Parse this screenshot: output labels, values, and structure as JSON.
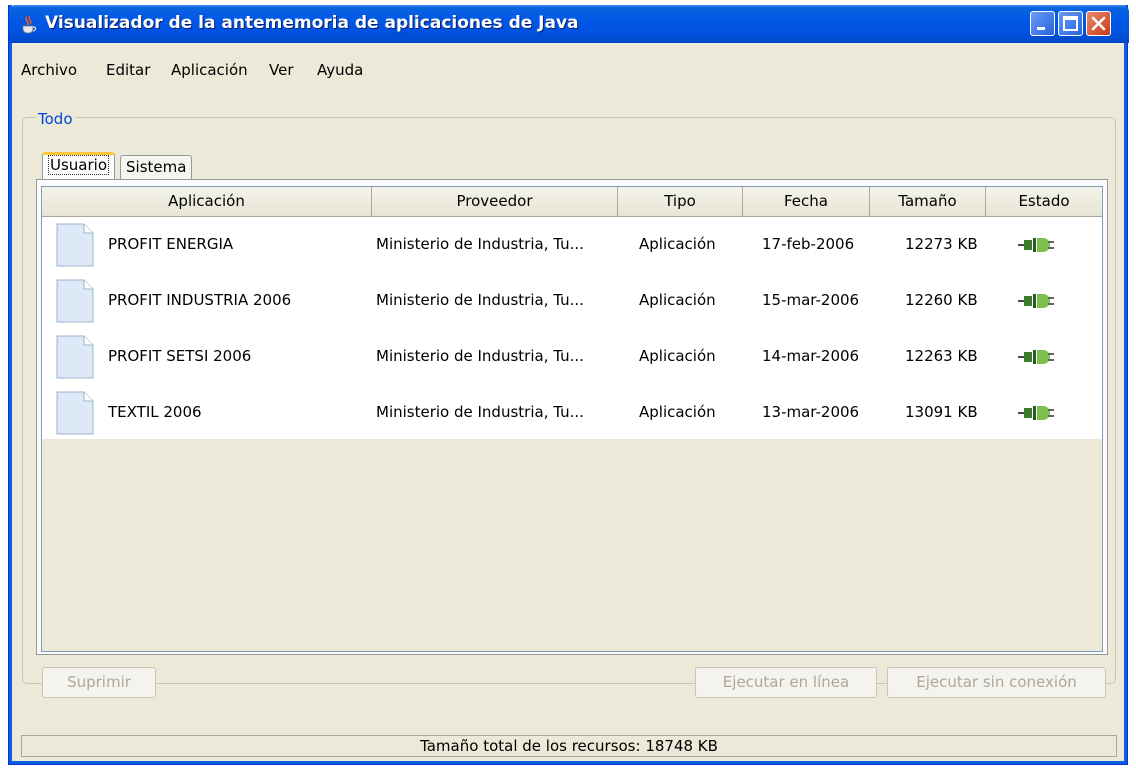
{
  "window": {
    "title": "Visualizador de la antememoria de aplicaciones de Java"
  },
  "menu": [
    "Archivo",
    "Editar",
    "Aplicación",
    "Ver",
    "Ayuda"
  ],
  "group_label": "Todo",
  "tabs": [
    "Usuario",
    "Sistema"
  ],
  "active_tab": "Usuario",
  "table": {
    "columns": [
      "Aplicación",
      "Proveedor",
      "Tipo",
      "Fecha",
      "Tamaño",
      "Estado"
    ],
    "rows": [
      {
        "app": "PROFIT ENERGIA",
        "vendor": "Ministerio de Industria, Tu...",
        "type": "Aplicación",
        "date": "17-feb-2006",
        "size": "12273 KB",
        "status_icon": "plug-icon"
      },
      {
        "app": "PROFIT INDUSTRIA 2006",
        "vendor": "Ministerio de Industria, Tu...",
        "type": "Aplicación",
        "date": "15-mar-2006",
        "size": "12260 KB",
        "status_icon": "plug-icon"
      },
      {
        "app": "PROFIT SETSI 2006",
        "vendor": "Ministerio de Industria, Tu...",
        "type": "Aplicación",
        "date": "14-mar-2006",
        "size": "12263 KB",
        "status_icon": "plug-icon"
      },
      {
        "app": "TEXTIL 2006",
        "vendor": "Ministerio de Industria, Tu...",
        "type": "Aplicación",
        "date": "13-mar-2006",
        "size": "13091 KB",
        "status_icon": "plug-icon"
      }
    ]
  },
  "buttons": {
    "delete": "Suprimir",
    "run_online": "Ejecutar en línea",
    "run_offline": "Ejecutar sin conexión"
  },
  "status": "Tamaño total de los recursos:  18748 KB",
  "colors": {
    "titlebar": "#0058E6",
    "face": "#ECE9D8",
    "group_label": "#0046D5",
    "tab_highlight": "#FFC73C",
    "close_button": "#C53A1B"
  }
}
